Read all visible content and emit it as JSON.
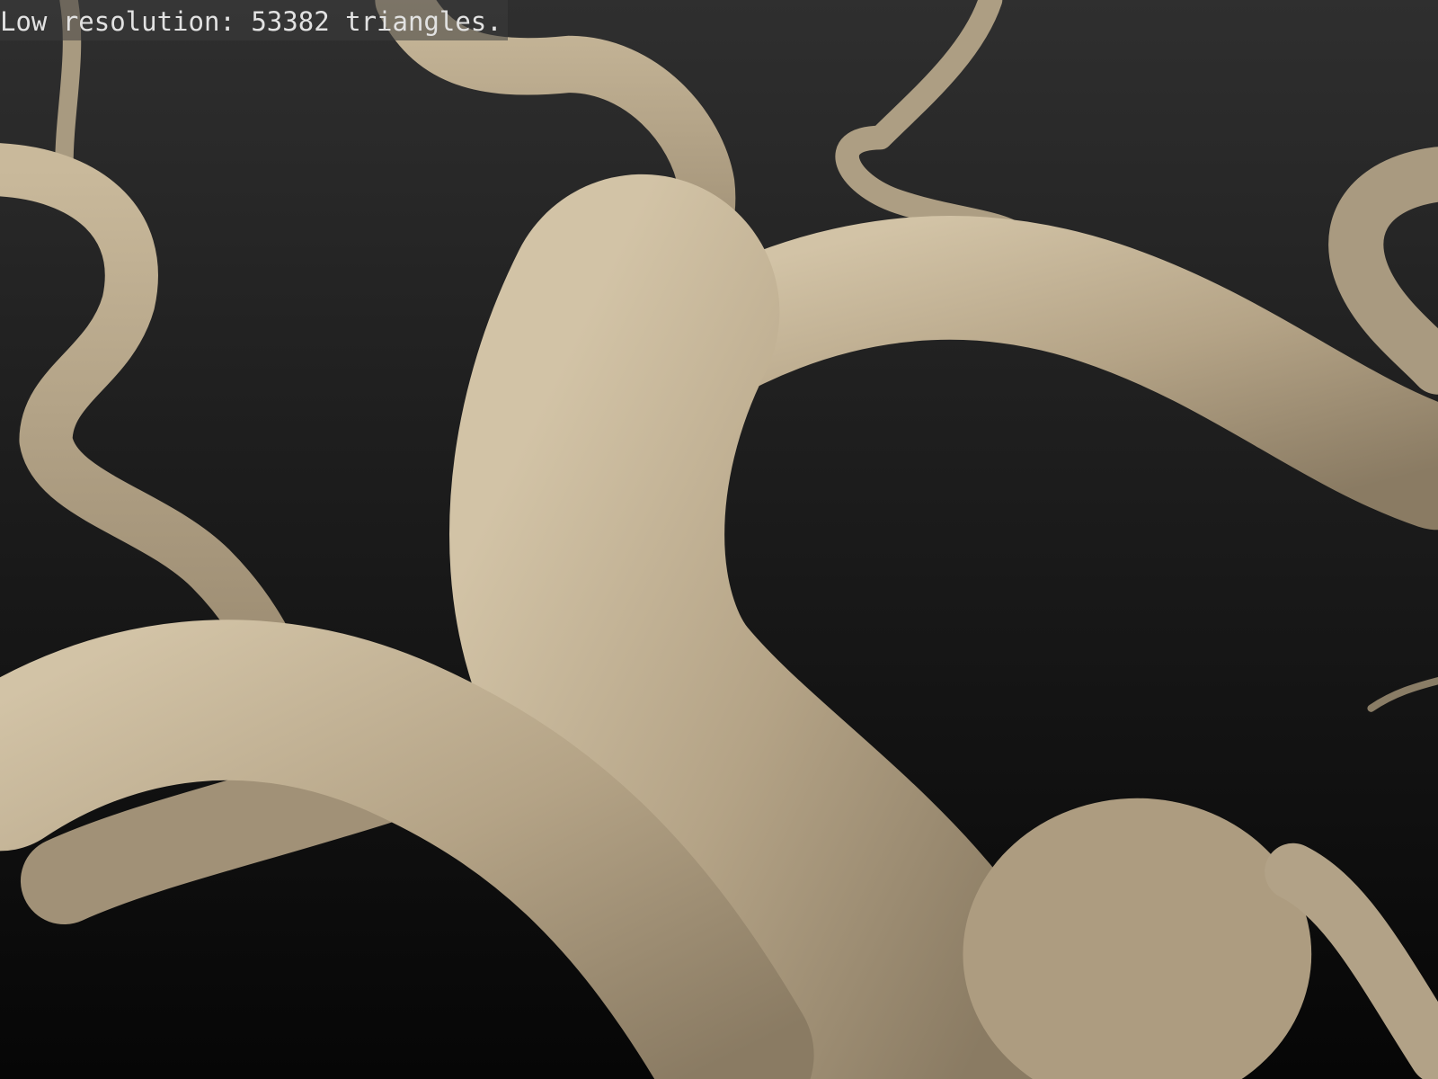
{
  "viewer": {
    "status_text": "Low resolution: 53382 triangles.",
    "model_color": "#b9a98c",
    "background_top": "#2f2f2f",
    "background_bottom": "#060606"
  }
}
